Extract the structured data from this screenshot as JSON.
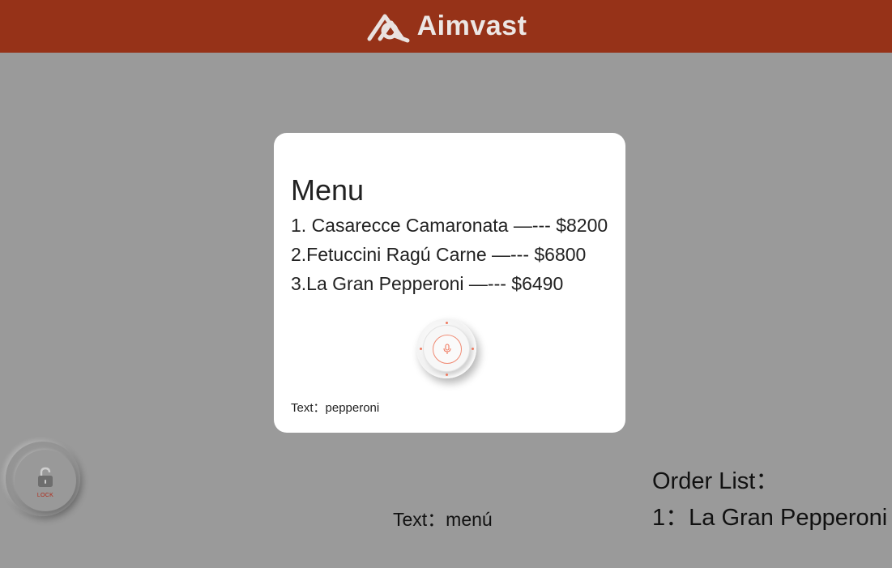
{
  "header": {
    "brand_name": "Aimvast",
    "logo_icon": "aimvast-logo-icon",
    "background_color": "#963218"
  },
  "modal": {
    "title": "Menu",
    "items": [
      {
        "label": "1. Casarecce Camaronata —--- $8200"
      },
      {
        "label": "2.Fetuccini Ragú Carne —--- $6800"
      },
      {
        "label": "3.La Gran Pepperoni —--- $6490"
      }
    ],
    "mic_icon": "microphone-icon",
    "status_text": "Text：pepperoni"
  },
  "lock_button": {
    "icon": "lock-icon",
    "label": "LOCK",
    "label_color": "#b02a1a"
  },
  "bottom_status_text": "Text：menú",
  "order_list": {
    "title": "Order List：",
    "items": [
      {
        "label": "1：La Gran Pepperoni"
      }
    ]
  },
  "colors": {
    "page_background": "#9a9a9a",
    "accent": "#ef7a60"
  }
}
